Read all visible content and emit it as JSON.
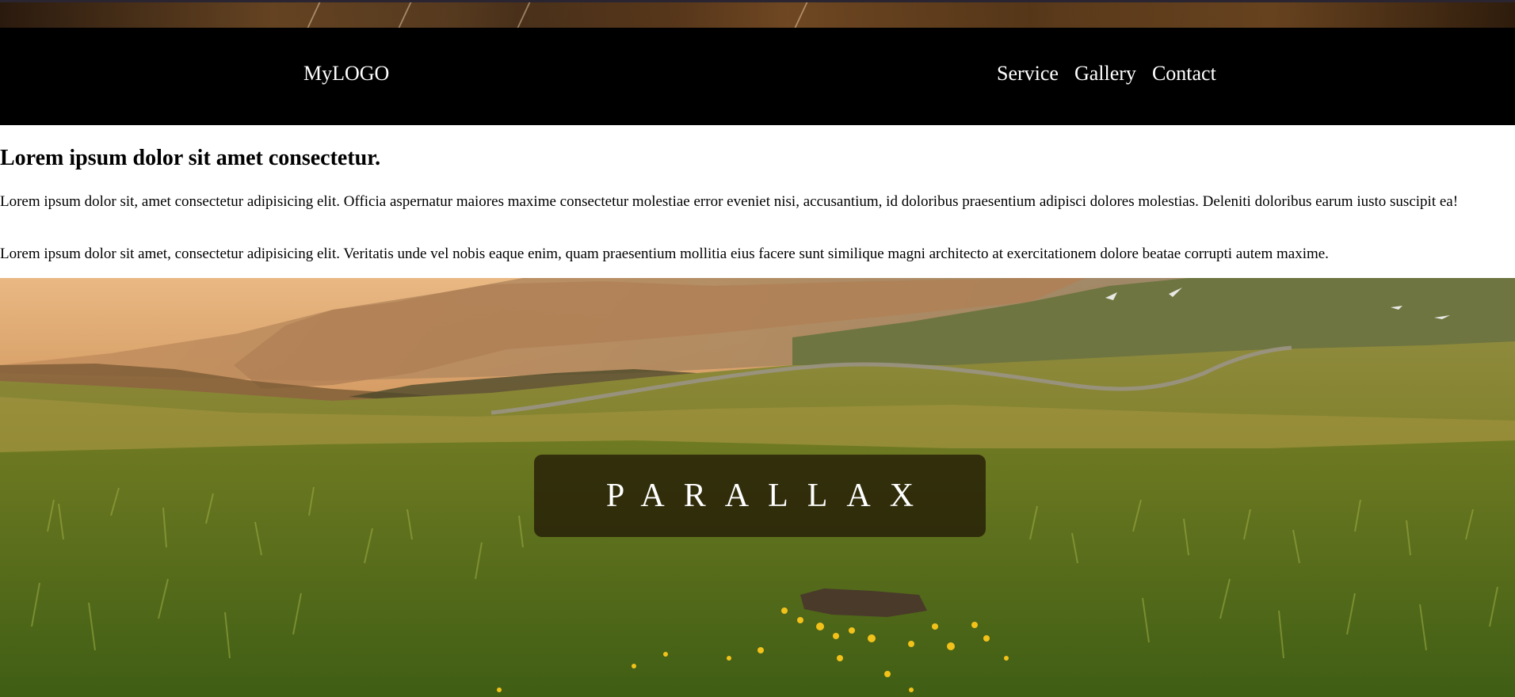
{
  "navbar": {
    "logo": "MyLOGO",
    "links": [
      {
        "label": "Service"
      },
      {
        "label": "Gallery"
      },
      {
        "label": "Contact"
      }
    ]
  },
  "content": {
    "heading": "Lorem ipsum dolor sit amet consectetur.",
    "paragraphs": [
      "Lorem ipsum dolor sit, amet consectetur adipisicing elit. Officia aspernatur maiores maxime consectetur molestiae error eveniet nisi, accusantium, id doloribus praesentium adipisci dolores molestias. Deleniti doloribus earum iusto suscipit ea!",
      "Lorem ipsum dolor sit amet, consectetur adipisicing elit. Veritatis unde vel nobis eaque enim, quam praesentium mollitia eius facere sunt similique magni architecto at exercitationem dolore beatae corrupti autem maxime."
    ]
  },
  "hero": {
    "title": "PARALLAX",
    "image": "mountain-meadow-landscape"
  },
  "colors": {
    "navbar_background": "#000000",
    "nav_text": "#ffffff",
    "overlay": "#221a06"
  }
}
